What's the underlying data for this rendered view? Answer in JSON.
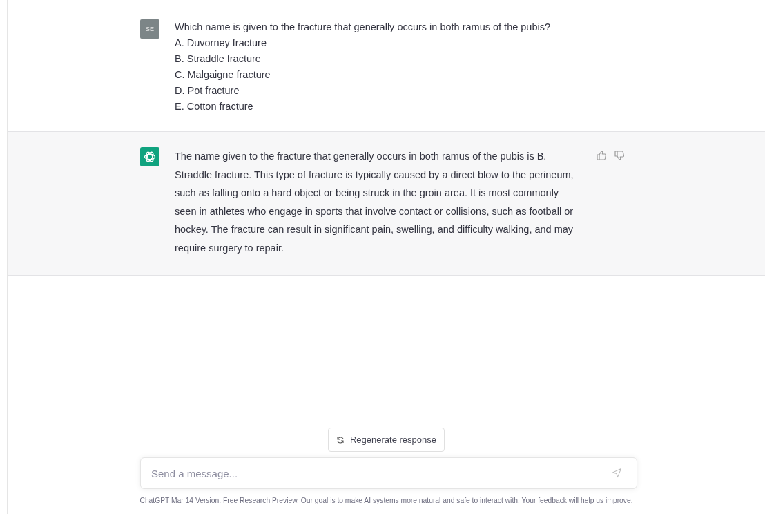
{
  "messages": [
    {
      "kind": "user",
      "avatar": "SE",
      "lines": [
        "Which name is given to the fracture that generally occurs in both ramus of the pubis?",
        "A. Duvorney fracture",
        "B. Straddle fracture",
        "C. Malgaigne fracture",
        "D. Pot fracture",
        "E. Cotton fracture"
      ]
    },
    {
      "kind": "assistant",
      "lines": [
        "The name given to the fracture that generally occurs in both ramus of the pubis is B. Straddle fracture. This type of fracture is typically caused by a direct blow to the perineum, such as falling onto a hard object or being struck in the groin area. It is most commonly seen in athletes who engage in sports that involve contact or collisions, such as football or hockey. The fracture can result in significant pain, swelling, and difficulty walking, and may require surgery to repair."
      ]
    }
  ],
  "regenerate_button": "Regenerate response",
  "composer": {
    "placeholder": "Send a message..."
  },
  "footer": {
    "link": "ChatGPT Mar 14 Version",
    "text": ". Free Research Preview. Our goal is to make AI systems more natural and safe to interact with. Your feedback will help us improve."
  }
}
